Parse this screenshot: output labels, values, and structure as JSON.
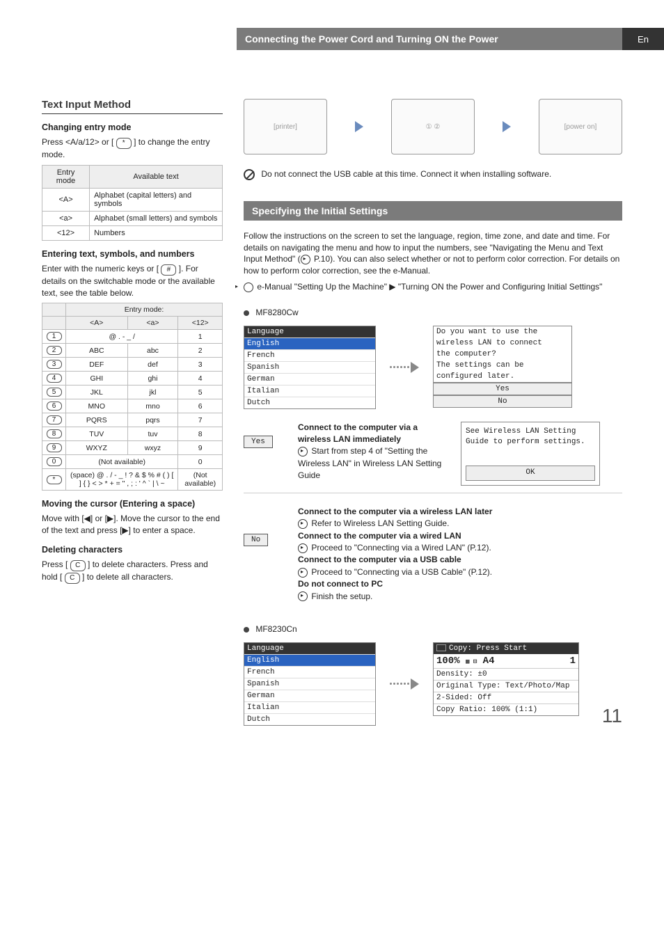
{
  "topbar": {
    "title": "Connecting the Power Cord and Turning ON the Power",
    "lang": "En"
  },
  "left": {
    "heading": "Text Input Method",
    "sub1": "Changing entry mode",
    "p1a": "Press <A/a/12> or [",
    "p1b": "] to change the entry mode.",
    "tbl1": {
      "h1": "Entry mode",
      "h2": "Available text",
      "r1c1": "<A>",
      "r1c2": "Alphabet (capital letters) and symbols",
      "r2c1": "<a>",
      "r2c2": "Alphabet (small letters) and symbols",
      "r3c1": "<12>",
      "r3c2": "Numbers"
    },
    "sub2": "Entering text, symbols, and numbers",
    "p2a": "Enter with the numeric keys or [",
    "p2b": "]. For details on the switchable mode or the available text, see the table below.",
    "tbl2": {
      "hmode": "Entry mode:",
      "hA": "<A>",
      "ha": "<a>",
      "h12": "<12>",
      "rows": [
        {
          "k": "1",
          "A": "@ . - _ /",
          "a": "",
          "n": "1",
          "span": true
        },
        {
          "k": "2",
          "A": "ABC",
          "a": "abc",
          "n": "2"
        },
        {
          "k": "3",
          "A": "DEF",
          "a": "def",
          "n": "3"
        },
        {
          "k": "4",
          "A": "GHI",
          "a": "ghi",
          "n": "4"
        },
        {
          "k": "5",
          "A": "JKL",
          "a": "jkl",
          "n": "5"
        },
        {
          "k": "6",
          "A": "MNO",
          "a": "mno",
          "n": "6"
        },
        {
          "k": "7",
          "A": "PQRS",
          "a": "pqrs",
          "n": "7"
        },
        {
          "k": "8",
          "A": "TUV",
          "a": "tuv",
          "n": "8"
        },
        {
          "k": "9",
          "A": "WXYZ",
          "a": "wxyz",
          "n": "9"
        },
        {
          "k": "0",
          "A": "(Not available)",
          "a": "",
          "n": "0",
          "span": true
        },
        {
          "k": "*",
          "A": "(space) @ . / - _ ! ? & $ % # ( ) [ ] { } < > * + = \" , ; : ' ^ ` | \\ ~",
          "a": "",
          "n": "(Not available)",
          "span": true
        }
      ]
    },
    "sub3": "Moving the cursor (Entering a space)",
    "p3": "Move with [◀] or [▶]. Move the cursor to the end of the text and press [▶] to enter a space.",
    "sub4": "Deleting characters",
    "p4a": "Press [",
    "p4b": "] to delete characters. Press and hold [",
    "p4c": "] to delete all characters."
  },
  "right": {
    "noUsb": "Do not connect the USB cable at this time. Connect it when installing software.",
    "section2": "Specifying the Initial Settings",
    "intro": "Follow the instructions on the screen to set the language, region, time zone, and date and time. For details on navigating the menu and how to input the numbers, see \"Navigating the Menu and Text Input Method\" (",
    "introPage": " P.10). You can also select whether or not to perform color correction. For details on how to perform color correction, see the e-Manual.",
    "eman": "e-Manual \"Setting Up the Machine\" ▶ \"Turning ON the Power and Configuring Initial Settings\"",
    "model1": "MF8280Cw",
    "lcd1": {
      "title": "Language",
      "sel": "English",
      "items": [
        "French",
        "Spanish",
        "German",
        "Italian",
        "Dutch"
      ]
    },
    "lcd2": {
      "l1": "Do you want to use the",
      "l2": "wireless LAN to connect",
      "l3": "the computer?",
      "l4": "The settings can be",
      "l5": "configured later.",
      "yes": "Yes",
      "no": "No"
    },
    "yesBlk": {
      "btn": "Yes",
      "h": "Connect to the computer via a wireless LAN immediately",
      "t": "Start from step 4 of \"Setting the Wireless LAN\" in Wireless LAN Setting Guide"
    },
    "lanBox": {
      "l1": "See Wireless LAN Setting",
      "l2": "Guide to perform settings.",
      "ok": "OK"
    },
    "noBlk": {
      "btn": "No",
      "h1": "Connect to the computer via a wireless LAN later",
      "t1": "Refer to Wireless LAN Setting Guide.",
      "h2": "Connect to the computer via a wired LAN",
      "t2": "Proceed to \"Connecting via a Wired LAN\" (P.12).",
      "h3": "Connect to the computer via a USB cable",
      "t3": "Proceed to \"Connecting via a USB Cable\" (P.12).",
      "h4": "Do not connect to PC",
      "t4": "Finish the setup."
    },
    "model2": "MF8230Cn",
    "lcd3": {
      "title": "Language",
      "sel": "English",
      "items": [
        "French",
        "Spanish",
        "German",
        "Italian",
        "Dutch"
      ]
    },
    "copy": {
      "top": "Copy: Press Start",
      "zoom": "100%",
      "paper": "A4",
      "count": "1",
      "r1": "Density: ±0",
      "r2": "Original Type: Text/Photo/Map",
      "r3": "2-Sided: Off",
      "r4": "Copy Ratio: 100% (1:1)"
    }
  },
  "keys": {
    "star": "*",
    "hash": "#",
    "c": "C"
  },
  "pageNum": "11"
}
